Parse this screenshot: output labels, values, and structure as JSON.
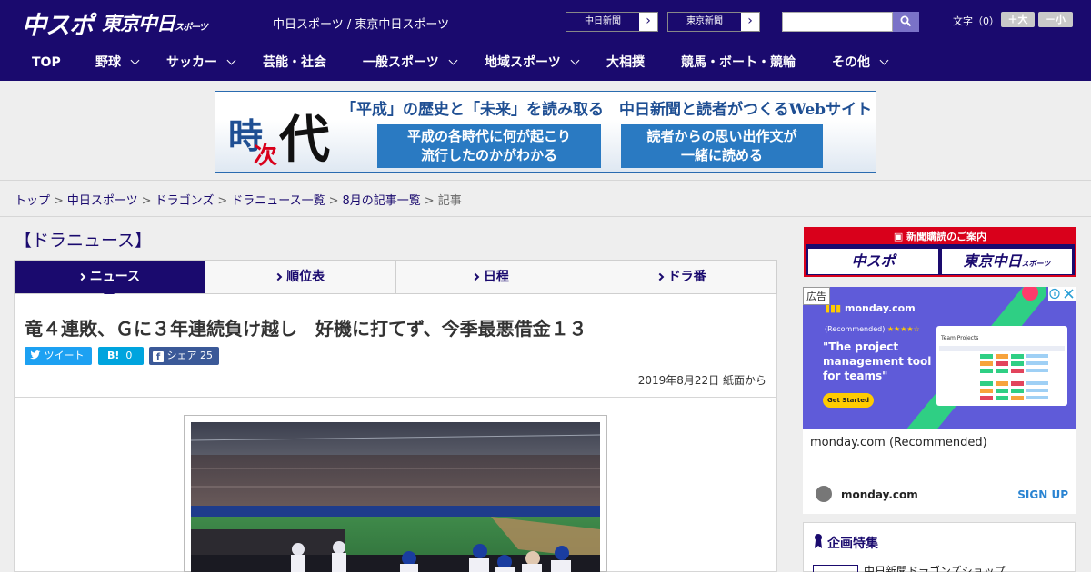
{
  "header": {
    "logo_chunichi_sports": "中スポ",
    "logo_tokyo_chunichi": "東京中日",
    "logo_tokyo_suffix": "スポーツ",
    "site_names": "中日スポーツ / 東京中日スポーツ",
    "paper_links": [
      "中日新聞",
      "東京新聞"
    ],
    "search_placeholder": "",
    "font_size_label": "文字（0）",
    "font_bigger": "＋大",
    "font_smaller": "－小"
  },
  "nav": {
    "items": [
      {
        "label": "TOP",
        "has_menu": false
      },
      {
        "label": "野球",
        "has_menu": true
      },
      {
        "label": "サッカー",
        "has_menu": true
      },
      {
        "label": "芸能・社会",
        "has_menu": false
      },
      {
        "label": "一般スポーツ",
        "has_menu": true
      },
      {
        "label": "地域スポーツ",
        "has_menu": true
      },
      {
        "label": "大相撲",
        "has_menu": false
      },
      {
        "label": "競馬・ボート・競輪",
        "has_menu": false
      },
      {
        "label": "その他",
        "has_menu": true
      }
    ]
  },
  "banner": {
    "logo_chars": [
      "時",
      "次",
      "代"
    ],
    "headline": "「平成」の歴史と「未来」を読み取る　中日新聞と読者がつくるWebサイト",
    "box_left": [
      "平成の各時代に何が起こり",
      "流行したのかがわかる"
    ],
    "box_right": [
      "読者からの思い出作文が",
      "一緒に読める"
    ]
  },
  "breadcrumb": {
    "links": [
      "トップ",
      "中日スポーツ",
      "ドラゴンズ",
      "ドラニュース一覧",
      "8月の記事一覧"
    ],
    "current": "記事",
    "separator": ">"
  },
  "section_title": "【ドラニュース】",
  "tabs": [
    {
      "label": "ニュース",
      "active": true
    },
    {
      "label": "順位表",
      "active": false
    },
    {
      "label": "日程",
      "active": false
    },
    {
      "label": "ドラ番",
      "active": false
    }
  ],
  "article": {
    "headline": "竜４連敗、Ｇに３年連続負け越し　好機に打てず、今季最悪借金１３",
    "share": {
      "tweet": "ツイート",
      "hatena_label": "B!",
      "hatena_count": "0",
      "facebook_label": "シェア",
      "facebook_count": "25"
    },
    "date": "2019年8月22日 紙面から"
  },
  "sidebar": {
    "subscription": {
      "top": "新聞購読のご案内",
      "logos": [
        "中スポ",
        "東京中日"
      ],
      "logo_suffix": "スポーツ"
    },
    "ad": {
      "label": "広告",
      "brand": "monday.com",
      "recommended": "(Recommended)",
      "tagline": "\"The project management tool for teams\"",
      "cta_image": "Get Started",
      "sponsor": "monday.com (Recommended)",
      "domain": "monday.com",
      "cta": "SIGN UP",
      "mock_title": "Team Projects"
    },
    "feature": {
      "title": "企画特集",
      "item": "中日新聞ドラゴンズショップ"
    }
  },
  "colors": {
    "brand_navy": "#1a0a6e",
    "banner_blue": "#2a7ac2",
    "ad_purple": "#5f5bd9",
    "hatena_blue": "#00a4de",
    "twitter_blue": "#1da1f2",
    "facebook_blue": "#3b5998",
    "subscription_red": "#d9001b"
  }
}
